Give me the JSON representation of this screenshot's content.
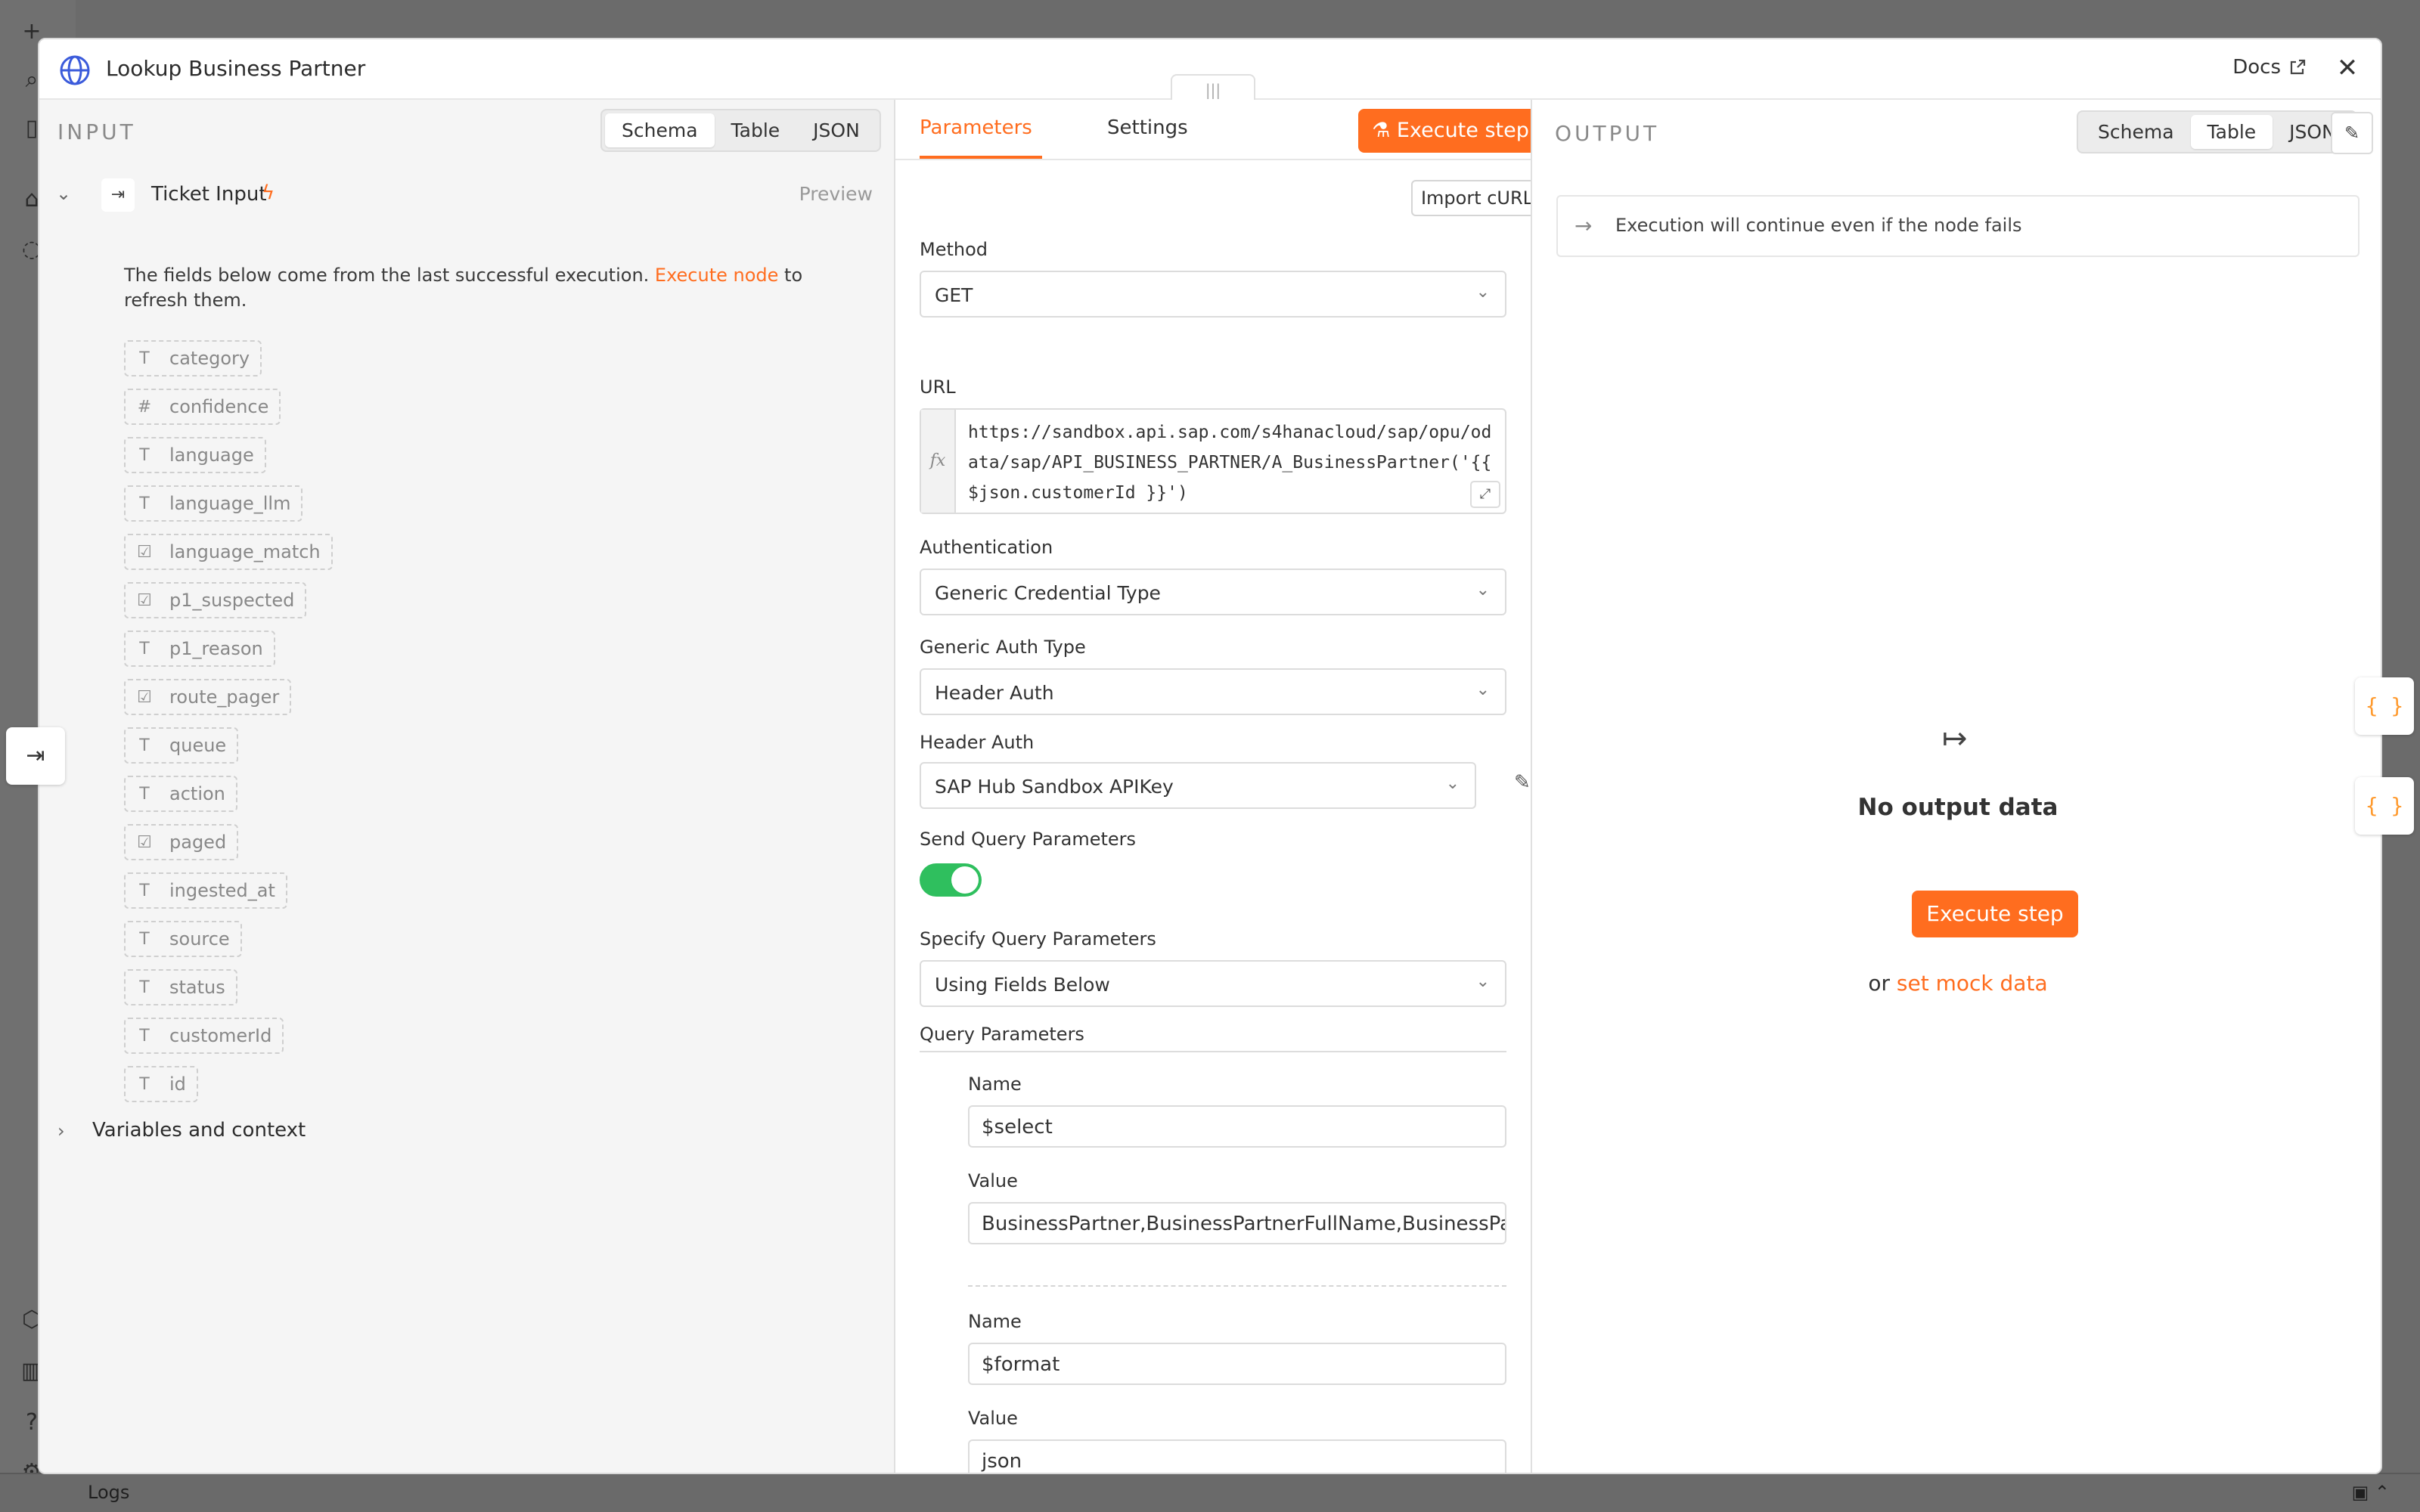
{
  "modal": {
    "title": "Lookup Business Partner",
    "docs_label": "Docs",
    "close_label": "✕",
    "drag_handle": "|||"
  },
  "input": {
    "heading": "INPUT",
    "view_tabs": [
      "Schema",
      "Table",
      "JSON"
    ],
    "active_view": "Schema",
    "node_name": "Ticket Input",
    "preview_label": "Preview",
    "info_before": "The fields below come from the last successful execution. ",
    "info_link": "Execute node",
    "info_after": " to refresh them.",
    "fields": [
      {
        "type": "T",
        "name": "category"
      },
      {
        "type": "#",
        "name": "confidence"
      },
      {
        "type": "T",
        "name": "language"
      },
      {
        "type": "T",
        "name": "language_llm"
      },
      {
        "type": "☑",
        "name": "language_match"
      },
      {
        "type": "☑",
        "name": "p1_suspected"
      },
      {
        "type": "T",
        "name": "p1_reason"
      },
      {
        "type": "☑",
        "name": "route_pager"
      },
      {
        "type": "T",
        "name": "queue"
      },
      {
        "type": "T",
        "name": "action"
      },
      {
        "type": "☑",
        "name": "paged"
      },
      {
        "type": "T",
        "name": "ingested_at"
      },
      {
        "type": "T",
        "name": "source"
      },
      {
        "type": "T",
        "name": "status"
      },
      {
        "type": "T",
        "name": "customerId"
      },
      {
        "type": "T",
        "name": "id"
      }
    ],
    "variables_label": "Variables and context"
  },
  "params": {
    "tab_parameters": "Parameters",
    "tab_settings": "Settings",
    "execute_label": "Execute step",
    "import_curl": "Import cURL",
    "method_label": "Method",
    "method_value": "GET",
    "url_label": "URL",
    "url_value": "https://sandbox.api.sap.com/s4hanacloud/sap/opu/odata/sap/API_BUSINESS_PARTNER/A_BusinessPartner('{{ $json.customerId }}')",
    "auth_label": "Authentication",
    "auth_value": "Generic Credential Type",
    "generic_auth_label": "Generic Auth Type",
    "generic_auth_value": "Header Auth",
    "header_auth_label": "Header Auth",
    "header_auth_value": "SAP Hub Sandbox APIKey",
    "send_query_label": "Send Query Parameters",
    "send_query_on": true,
    "specify_query_label": "Specify Query Parameters",
    "specify_query_value": "Using Fields Below",
    "query_params_label": "Query Parameters",
    "query_params": [
      {
        "name_label": "Name",
        "name": "$select",
        "value_label": "Value",
        "value": "BusinessPartner,BusinessPartnerFullName,BusinessPartnerCategory"
      },
      {
        "name_label": "Name",
        "name": "$format",
        "value_label": "Value",
        "value": "json"
      }
    ]
  },
  "output": {
    "heading": "OUTPUT",
    "view_tabs": [
      "Schema",
      "Table",
      "JSON"
    ],
    "active_view": "Table",
    "notice": "Execution will continue even if the node fails",
    "empty_title": "No output data",
    "execute_label": "Execute step",
    "or_text": "or ",
    "mock_link": "set mock data"
  },
  "app": {
    "logs_label": "Logs"
  },
  "colors": {
    "accent": "#ff6d1f",
    "toggle_on": "#2fbf5e"
  }
}
